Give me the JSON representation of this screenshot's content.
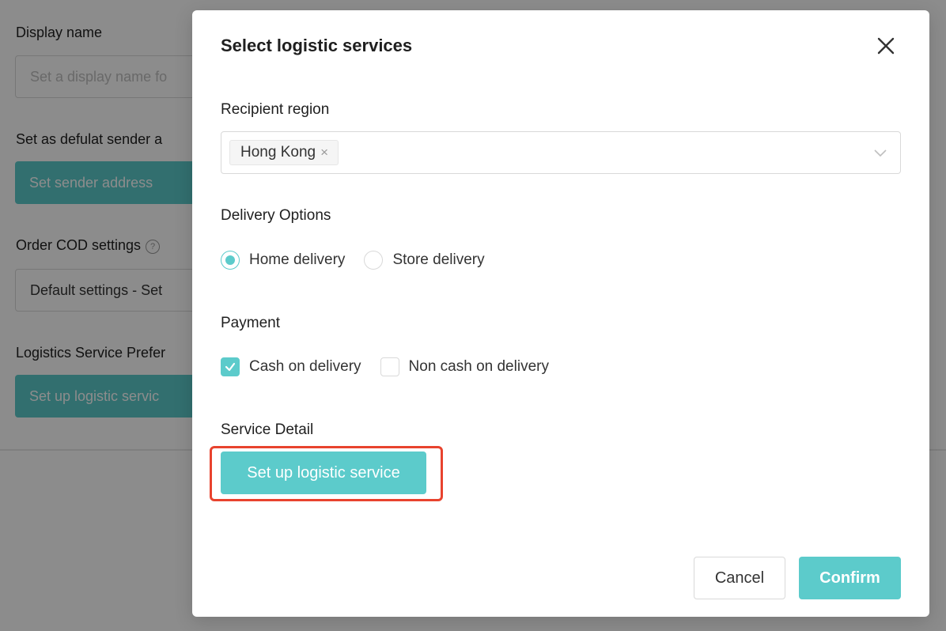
{
  "background": {
    "display_name_label": "Display name",
    "display_name_placeholder": "Set a display name fo",
    "default_sender_label": "Set as defulat sender a",
    "sender_button": "Set sender address",
    "cod_label": "Order COD settings",
    "cod_help_icon": "question-circle-icon",
    "cod_select_value": "Default settings - Set",
    "logistics_pref_label": "Logistics Service Prefer",
    "logistics_button": "Set up logistic servic"
  },
  "modal": {
    "title": "Select logistic services",
    "close_icon": "close-icon",
    "recipient_region": {
      "label": "Recipient region",
      "selected_tags": [
        "Hong Kong"
      ],
      "tag_remove_glyph": "×",
      "dropdown_icon": "chevron-down-icon"
    },
    "delivery_options": {
      "label": "Delivery Options",
      "options": [
        {
          "label": "Home delivery",
          "checked": true
        },
        {
          "label": "Store delivery",
          "checked": false
        }
      ]
    },
    "payment": {
      "label": "Payment",
      "options": [
        {
          "label": "Cash on delivery",
          "checked": true
        },
        {
          "label": "Non cash on delivery",
          "checked": false
        }
      ]
    },
    "service_detail": {
      "label": "Service Detail",
      "button": "Set up logistic service",
      "highlighted": true
    },
    "footer": {
      "cancel": "Cancel",
      "confirm": "Confirm"
    }
  },
  "colors": {
    "accent": "#5ccbcb",
    "highlight": "#e8432e",
    "overlay": "rgba(0,0,0,0.45)"
  }
}
